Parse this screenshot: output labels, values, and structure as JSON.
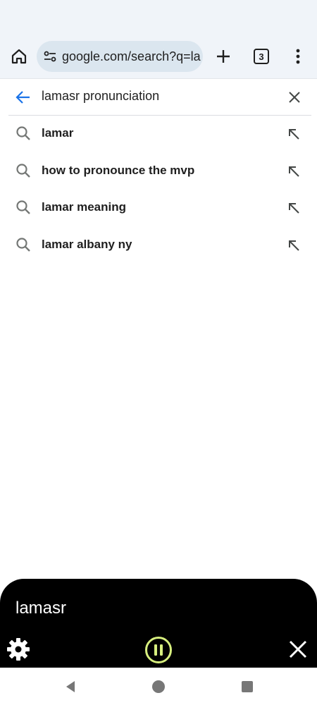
{
  "toolbar": {
    "url": "google.com/search?q=la",
    "tab_count": "3"
  },
  "search": {
    "query": "lamasr pronunciation"
  },
  "suggestions": [
    {
      "text": "lamar"
    },
    {
      "text": "how to pronounce the mvp"
    },
    {
      "text": "lamar meaning"
    },
    {
      "text": "lamar albany ny"
    }
  ],
  "player": {
    "current_word": "lamasr",
    "accent_color": "#d7ef7e"
  },
  "icons": {
    "home": "home-icon",
    "tune": "tune-icon",
    "new_tab": "plus-icon",
    "tab_switcher": "tab-count-icon",
    "menu": "more-vert-icon",
    "back": "arrow-back-icon",
    "clear": "close-icon",
    "suggestion": "search-icon",
    "refine": "arrow-up-left-icon",
    "settings": "gear-icon",
    "pause": "pause-icon",
    "close_player": "close-icon"
  }
}
